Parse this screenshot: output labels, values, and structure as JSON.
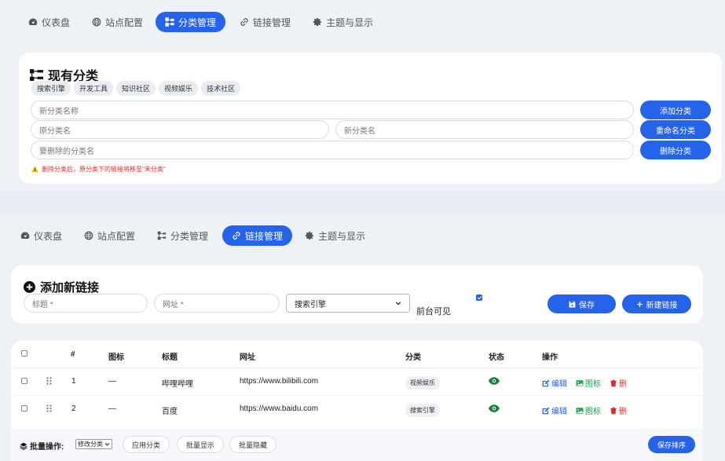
{
  "pane1": {
    "tabs": [
      {
        "label": "仪表盘",
        "icon": "gauge-icon"
      },
      {
        "label": "站点配置",
        "icon": "globe-icon"
      },
      {
        "label": "分类管理",
        "icon": "sitemap-icon"
      },
      {
        "label": "链接管理",
        "icon": "link-icon"
      },
      {
        "label": "主题与显示",
        "icon": "gear-icon"
      }
    ],
    "active_tab": "分类管理",
    "title": "现有分类",
    "chips": [
      "搜索引擎",
      "开发工具",
      "知识社区",
      "视频娱乐",
      "技术社区"
    ],
    "new_category_placeholder": "新分类名称",
    "add_button": "添加分类",
    "old_name_placeholder": "原分类名",
    "new_name_placeholder": "新分类名",
    "rename_button": "重命名分类",
    "delete_name_placeholder": "要删除的分类名",
    "delete_button": "删除分类",
    "warning": "删除分类后，原分类下的链接将移至\"未分类\""
  },
  "pane2": {
    "tabs": [
      {
        "label": "仪表盘",
        "icon": "gauge-icon"
      },
      {
        "label": "站点配置",
        "icon": "globe-icon"
      },
      {
        "label": "分类管理",
        "icon": "sitemap-icon"
      },
      {
        "label": "链接管理",
        "icon": "link-icon"
      },
      {
        "label": "主题与显示",
        "icon": "gear-icon"
      }
    ],
    "active_tab": "链接管理",
    "add_link_title": "添加新链接",
    "title_placeholder": "标题 *",
    "url_placeholder": "网址 *",
    "category_selected": "搜索引擎",
    "visible_label": "前台可见",
    "visible_checked": true,
    "save_button": "保存",
    "new_link_button": "新建链接",
    "table": {
      "headers": [
        "#",
        "图标",
        "标题",
        "网址",
        "分类",
        "状态",
        "操作"
      ],
      "rows": [
        {
          "num": "1",
          "icon": "—",
          "title": "哔哩哔哩",
          "url": "https://www.bilibili.com",
          "category": "视频娱乐"
        },
        {
          "num": "2",
          "icon": "—",
          "title": "百度",
          "url": "https://www.baidu.com",
          "category": "搜索引擎"
        }
      ],
      "actions": {
        "edit": "编辑",
        "icon": "图标",
        "delete": "删"
      }
    },
    "batch": {
      "label": "批量操作:",
      "select_value": "修改分类",
      "apply": "应用分类",
      "show": "批量显示",
      "hide": "批量隐藏",
      "save_order": "保存排序"
    }
  },
  "colors": {
    "accent": "#2563eb",
    "danger": "#d93025",
    "success": "#16a34a",
    "eye_green": "#15803d"
  }
}
